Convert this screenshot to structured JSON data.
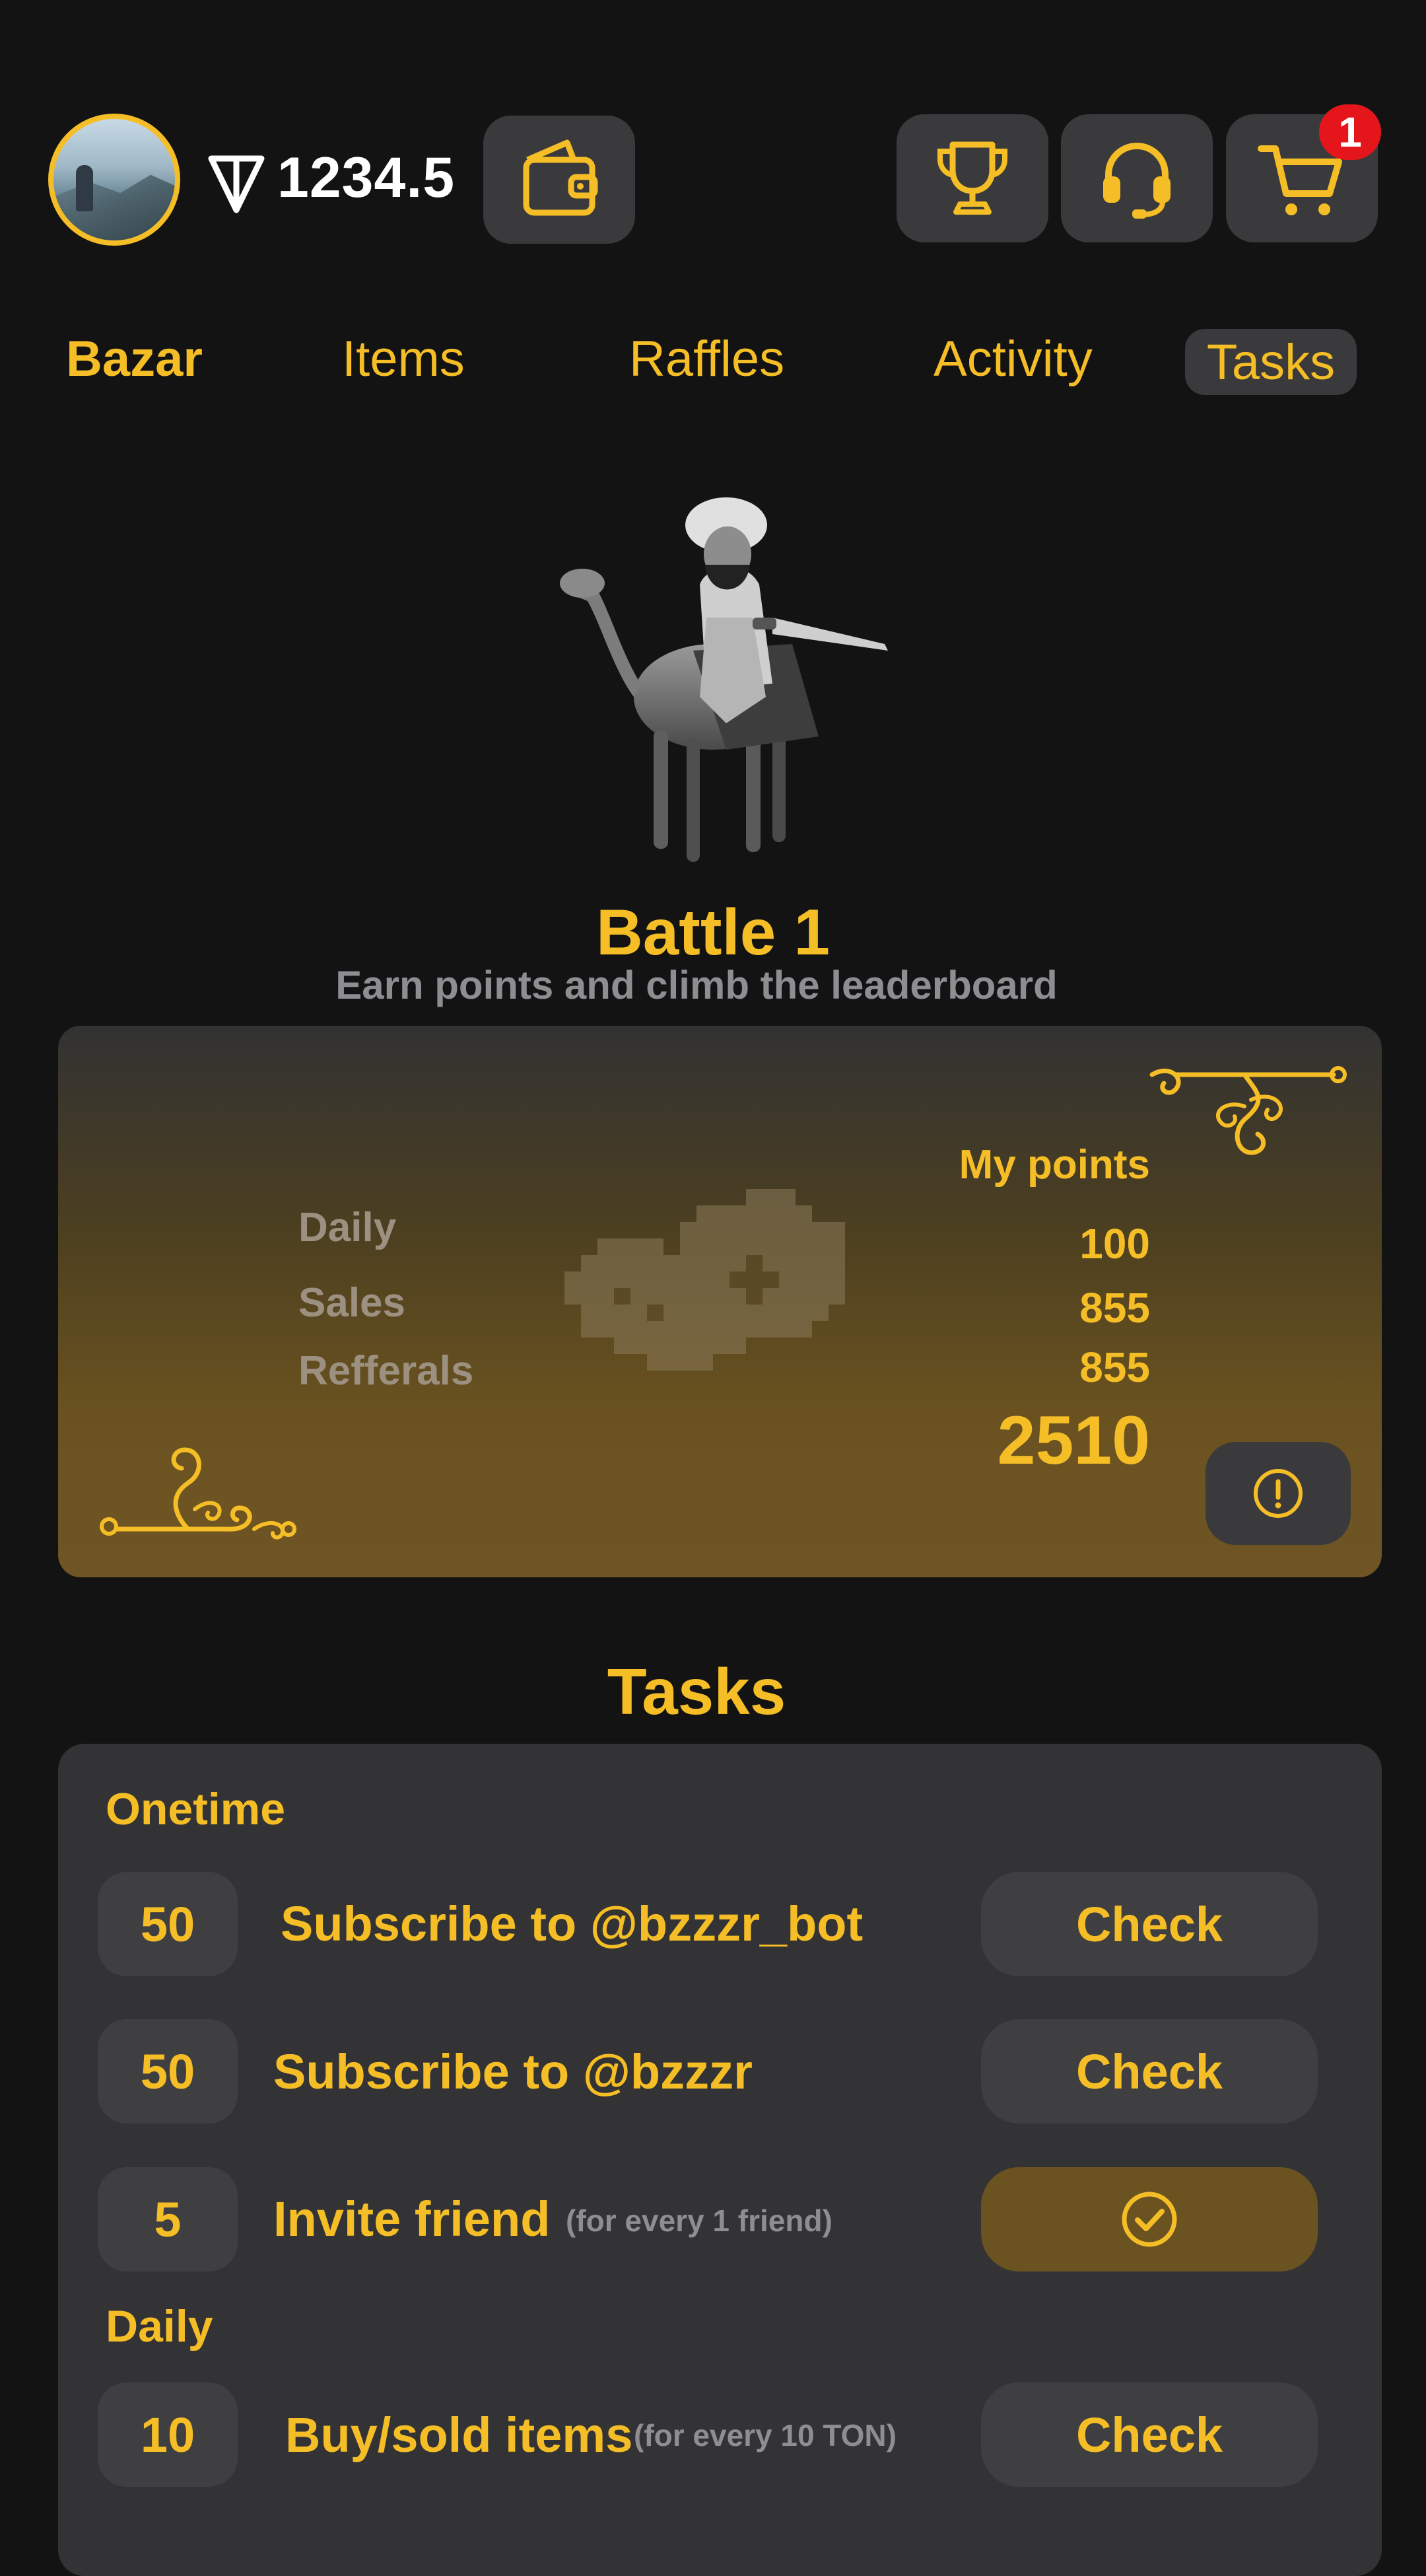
{
  "header": {
    "balance": "1234.5",
    "cart_badge": "1",
    "icons": [
      "avatar",
      "ton-icon",
      "wallet-icon",
      "trophy-icon",
      "headset-icon",
      "cart-icon"
    ]
  },
  "nav": {
    "tabs": [
      "Bazar",
      "Items",
      "Raffles",
      "Activity",
      "Tasks"
    ],
    "active": "Tasks"
  },
  "hero": {
    "title": "Battle 1",
    "subtitle": "Earn points and climb the leaderboard"
  },
  "points": {
    "my_points_label": "My points",
    "rows": [
      {
        "label": "Daily",
        "value": "100"
      },
      {
        "label": "Sales",
        "value": "855"
      },
      {
        "label": "Refferals",
        "value": "855"
      }
    ],
    "total": "2510"
  },
  "tasks": {
    "title": "Tasks",
    "sections": [
      {
        "label": "Onetime",
        "items": [
          {
            "points": "50",
            "name": "Subscribe to @bzzzr_bot",
            "note": "",
            "action": "Check",
            "done": false
          },
          {
            "points": "50",
            "name": "Subscribe to @bzzzr",
            "note": "",
            "action": "Check",
            "done": false
          },
          {
            "points": "5",
            "name": "Invite friend",
            "note": "(for every 1 friend)",
            "action": "",
            "done": true
          }
        ]
      },
      {
        "label": "Daily",
        "items": [
          {
            "points": "10",
            "name": "Buy/sold items",
            "note": "(for every 10 TON)",
            "action": "Check",
            "done": false
          }
        ]
      }
    ]
  },
  "colors": {
    "background": "#131314",
    "accent": "#F5BE26",
    "surface": "#3a3a3c",
    "card": "#333335",
    "badge": "#E5161B",
    "done_button": "#6b5221",
    "muted_text": "#8e8e92"
  }
}
